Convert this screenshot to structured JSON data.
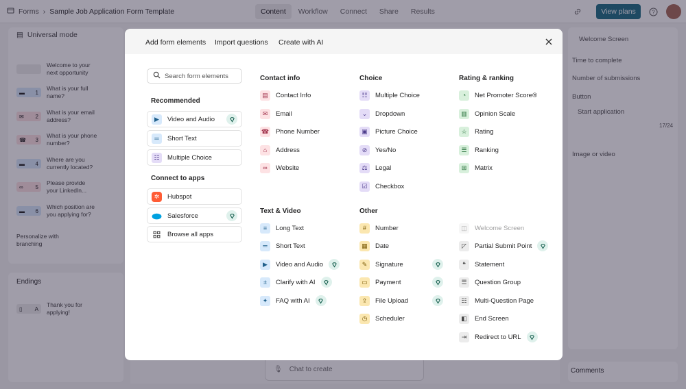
{
  "app": {
    "breadcrumb_root": "Forms",
    "form_title": "Sample Job Application Form Template",
    "tabs": [
      "Content",
      "Workflow",
      "Connect",
      "Share",
      "Results"
    ],
    "view_plans": "View plans"
  },
  "left": {
    "mode": "Universal mode",
    "questions": [
      {
        "num": "",
        "text": "Welcome to your\nnext opportunity",
        "color": "#ececec"
      },
      {
        "num": "1",
        "text": "What is your full\nname?",
        "color": "#d7e9fb"
      },
      {
        "num": "2",
        "text": "What is your email\naddress?",
        "color": "#fde2e4"
      },
      {
        "num": "3",
        "text": "What is your phone\nnumber?",
        "color": "#fde2e4"
      },
      {
        "num": "4",
        "text": "Where are you\ncurrently located?",
        "color": "#d7e9fb"
      },
      {
        "num": "5",
        "text": "Please provide\nyour LinkedIn...",
        "color": "#fde2e4"
      },
      {
        "num": "6",
        "text": "Which position are\nyou applying for?",
        "color": "#d7e9fb"
      }
    ],
    "personalize": "Personalize with\nbranching",
    "endings_label": "Endings",
    "ending": {
      "num": "A",
      "text": "Thank you for\napplying!"
    }
  },
  "right": {
    "screen_select": "Welcome Screen",
    "time_to_complete": "Time to complete",
    "num_submissions": "Number of submissions",
    "button_label": "Button",
    "button_value": "Start application",
    "char_count": "17/24",
    "image_or_video": "Image or video",
    "comments": "Comments"
  },
  "chat_placeholder": "Chat to create",
  "modal": {
    "tabs": [
      "Add form elements",
      "Import questions",
      "Create with AI"
    ],
    "search_placeholder": "Search form elements",
    "recommended_title": "Recommended",
    "recommended": [
      {
        "label": "Video and Audio",
        "icon": "video-icon",
        "bg": "#d7e9fb",
        "fg": "#1f5f8b",
        "premium": true
      },
      {
        "label": "Short Text",
        "icon": "short-text-icon",
        "bg": "#d7e9fb",
        "fg": "#1f5f8b",
        "premium": false
      },
      {
        "label": "Multiple Choice",
        "icon": "multiple-choice-icon",
        "bg": "#e4dcf7",
        "fg": "#4b3a8b",
        "premium": false
      }
    ],
    "connect_title": "Connect to apps",
    "apps": [
      {
        "label": "Hubspot",
        "icon": "hubspot-icon",
        "premium": false
      },
      {
        "label": "Salesforce",
        "icon": "salesforce-icon",
        "premium": true
      },
      {
        "label": "Browse all apps",
        "icon": "apps-grid-icon",
        "premium": false
      }
    ],
    "columns": {
      "contact": {
        "title": "Contact info",
        "items": [
          {
            "label": "Contact Info",
            "icon": "contact-card-icon"
          },
          {
            "label": "Email",
            "icon": "email-icon"
          },
          {
            "label": "Phone Number",
            "icon": "phone-icon"
          },
          {
            "label": "Address",
            "icon": "address-icon"
          },
          {
            "label": "Website",
            "icon": "link-icon"
          }
        ]
      },
      "choice": {
        "title": "Choice",
        "items": [
          {
            "label": "Multiple Choice",
            "icon": "multiple-choice-icon"
          },
          {
            "label": "Dropdown",
            "icon": "dropdown-icon"
          },
          {
            "label": "Picture Choice",
            "icon": "picture-choice-icon"
          },
          {
            "label": "Yes/No",
            "icon": "yes-no-icon"
          },
          {
            "label": "Legal",
            "icon": "legal-icon"
          },
          {
            "label": "Checkbox",
            "icon": "checkbox-icon"
          }
        ]
      },
      "rating": {
        "title": "Rating & ranking",
        "items": [
          {
            "label": "Net Promoter Score®",
            "icon": "gauge-icon"
          },
          {
            "label": "Opinion Scale",
            "icon": "opinion-scale-icon"
          },
          {
            "label": "Rating",
            "icon": "star-icon"
          },
          {
            "label": "Ranking",
            "icon": "ranking-icon"
          },
          {
            "label": "Matrix",
            "icon": "matrix-icon"
          }
        ]
      },
      "text_video": {
        "title": "Text & Video",
        "items": [
          {
            "label": "Long Text",
            "icon": "long-text-icon",
            "premium": false
          },
          {
            "label": "Short Text",
            "icon": "short-text-icon",
            "premium": false
          },
          {
            "label": "Video and Audio",
            "icon": "video-icon",
            "premium": true
          },
          {
            "label": "Clarify with AI",
            "icon": "clarify-ai-icon",
            "premium": true
          },
          {
            "label": "FAQ with AI",
            "icon": "faq-ai-icon",
            "premium": true
          }
        ]
      },
      "other": {
        "title": "Other",
        "items": [
          {
            "label": "Number",
            "icon": "hash-icon",
            "premium": false
          },
          {
            "label": "Date",
            "icon": "calendar-icon",
            "premium": false
          },
          {
            "label": "Signature",
            "icon": "signature-icon",
            "premium": true
          },
          {
            "label": "Payment",
            "icon": "payment-icon",
            "premium": true
          },
          {
            "label": "File Upload",
            "icon": "upload-icon",
            "premium": true
          },
          {
            "label": "Scheduler",
            "icon": "scheduler-icon",
            "premium": false
          }
        ]
      },
      "structure": {
        "title": "",
        "items": [
          {
            "label": "Welcome Screen",
            "icon": "welcome-screen-icon",
            "premium": false,
            "disabled": true
          },
          {
            "label": "Partial Submit Point",
            "icon": "partial-submit-icon",
            "premium": true
          },
          {
            "label": "Statement",
            "icon": "quote-icon",
            "premium": false
          },
          {
            "label": "Question Group",
            "icon": "question-group-icon",
            "premium": false
          },
          {
            "label": "Multi-Question Page",
            "icon": "multi-question-icon",
            "premium": false
          },
          {
            "label": "End Screen",
            "icon": "end-screen-icon",
            "premium": false
          },
          {
            "label": "Redirect to URL",
            "icon": "redirect-icon",
            "premium": true
          }
        ]
      }
    }
  }
}
